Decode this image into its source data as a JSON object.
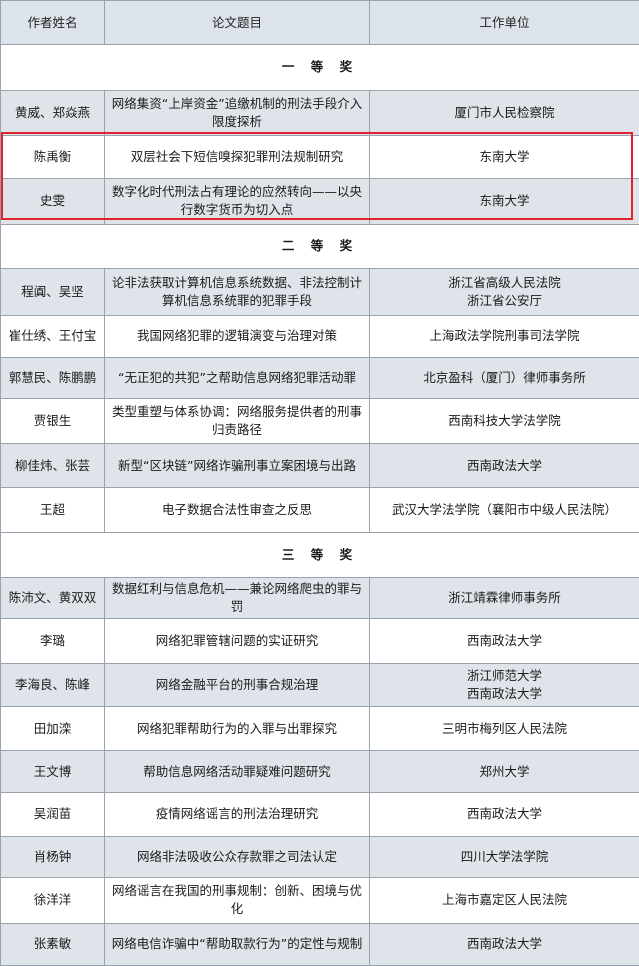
{
  "header": {
    "author": "作者姓名",
    "title": "论文题目",
    "unit": "工作单位"
  },
  "sections": [
    {
      "label": "一 等 奖",
      "rows": [
        {
          "author": "黄威、郑焱燕",
          "title": "网络集资“上岸资金”追缴机制的刑法手段介入限度探析",
          "units": [
            "厦门市人民检察院"
          ]
        },
        {
          "author": "陈禹衡",
          "title": "双层社会下短信嗅探犯罪刑法规制研究",
          "units": [
            "东南大学"
          ]
        },
        {
          "author": "史雯",
          "title": "数字化时代刑法占有理论的应然转向——以央行数字货币为切入点",
          "units": [
            "东南大学"
          ]
        }
      ]
    },
    {
      "label": "二 等 奖",
      "rows": [
        {
          "author": "程阗、吴坚",
          "title": "论非法获取计算机信息系统数据、非法控制计算机信息系统罪的犯罪手段",
          "units": [
            "浙江省高级人民法院",
            "浙江省公安厅"
          ]
        },
        {
          "author": "崔仕绣、王付宝",
          "title": "我国网络犯罪的逻辑演变与治理对策",
          "units": [
            "上海政法学院刑事司法学院"
          ]
        },
        {
          "author": "郭慧民、陈鹏鹏",
          "title": "“无正犯的共犯”之帮助信息网络犯罪活动罪",
          "units": [
            "北京盈科（厦门）律师事务所"
          ]
        },
        {
          "author": "贾银生",
          "title": "类型重塑与体系协调：网络服务提供者的刑事归责路径",
          "units": [
            "西南科技大学法学院"
          ]
        },
        {
          "author": "柳佳炜、张芸",
          "title": "新型“区块链”网络诈骗刑事立案困境与出路",
          "units": [
            "西南政法大学"
          ]
        },
        {
          "author": "王超",
          "title": "电子数据合法性审查之反思",
          "units": [
            "武汉大学法学院（襄阳市中级人民法院）"
          ]
        }
      ]
    },
    {
      "label": "三 等 奖",
      "rows": [
        {
          "author": "陈沛文、黄双双",
          "title": "数据红利与信息危机——兼论网络爬虫的罪与罚",
          "units": [
            "浙江靖霖律师事务所"
          ]
        },
        {
          "author": "李璐",
          "title": "网络犯罪管辖问题的实证研究",
          "units": [
            "西南政法大学"
          ]
        },
        {
          "author": "李海良、陈峰",
          "title": "网络金融平台的刑事合规治理",
          "units": [
            "浙江师范大学",
            "西南政法大学"
          ]
        },
        {
          "author": "田加滦",
          "title": "网络犯罪帮助行为的入罪与出罪探究",
          "units": [
            "三明市梅列区人民法院"
          ]
        },
        {
          "author": "王文博",
          "title": "帮助信息网络活动罪疑难问题研究",
          "units": [
            "郑州大学"
          ]
        },
        {
          "author": "吴润苗",
          "title": "疫情网络谣言的刑法治理研究",
          "units": [
            "西南政法大学"
          ]
        },
        {
          "author": "肖杨钟",
          "title": "网络非法吸收公众存款罪之司法认定",
          "units": [
            "四川大学法学院"
          ]
        },
        {
          "author": "徐洋洋",
          "title": "网络谣言在我国的刑事规制：创新、困境与优化",
          "units": [
            "上海市嘉定区人民法院"
          ]
        },
        {
          "author": "张素敏",
          "title": "网络电信诈骗中“帮助取款行为”的定性与规制",
          "units": [
            "西南政法大学"
          ]
        }
      ]
    }
  ],
  "colors": {
    "highlight": "#e0232d",
    "row_alt": "#dfe4ea",
    "header_bg": "#dde3ea",
    "border": "#9aa3ad"
  }
}
